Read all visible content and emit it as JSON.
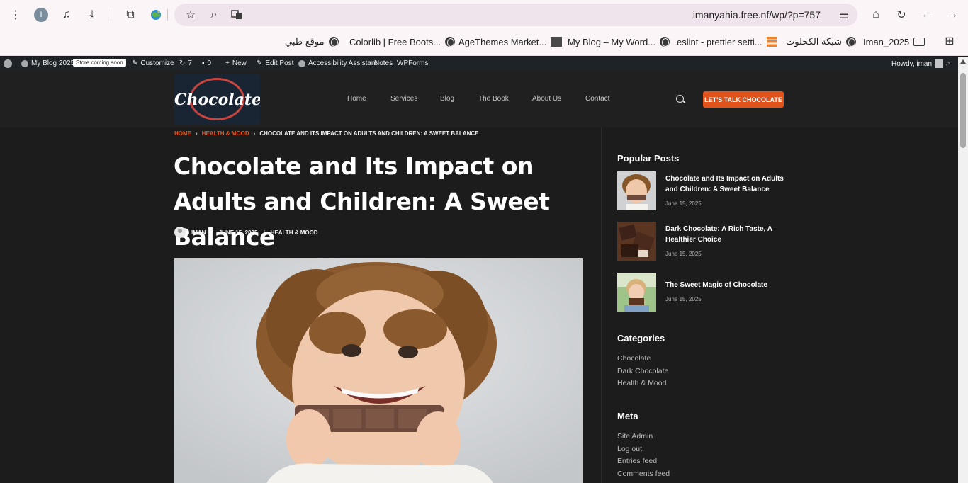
{
  "browser": {
    "url": "imanyahia.free.nf/wp/?p=757",
    "profile_initial": "I",
    "bookmarks": [
      {
        "label": "موقع طبي",
        "icon": "globe-icon"
      },
      {
        "label": "Colorlib | Free Boots...",
        "icon": "globe-icon"
      },
      {
        "label": "AgeThemes Market...",
        "icon": "site-icon"
      },
      {
        "label": "My Blog – My Word...",
        "icon": "globe-icon"
      },
      {
        "label": "eslint - prettier setti...",
        "icon": "stackoverflow-icon"
      },
      {
        "label": "شبكة الكحلوت",
        "icon": "globe-icon"
      },
      {
        "label": "Iman_2025",
        "icon": "folder-icon"
      }
    ]
  },
  "adminbar": {
    "site_name": "My Blog 2025",
    "badge": "Store coming soon",
    "customize": "Customize",
    "updates": "7",
    "comments": "0",
    "new": "New",
    "edit_post": "Edit Post",
    "accessibility": "Accessibility Assistant",
    "notes": "Notes",
    "wpforms": "WPForms",
    "howdy": "Howdy, iman"
  },
  "site": {
    "logo_text": "Chocolate",
    "nav": [
      "Home",
      "Services",
      "Blog",
      "The Book",
      "About Us",
      "Contact"
    ],
    "cta": "LET'S TALK CHOCOLATE"
  },
  "post": {
    "breadcrumb": [
      "HOME",
      "HEALTH & MOOD",
      "CHOCOLATE AND ITS IMPACT ON ADULTS AND CHILDREN: A SWEET BALANCE"
    ],
    "title": "Chocolate and Its Impact on Adults and Children: A Sweet Balance",
    "author": "IMAN",
    "date": "JUNE 15, 2025",
    "category": "HEALTH & MOOD"
  },
  "sidebar": {
    "popular_heading": "Popular Posts",
    "popular": [
      {
        "title": "Chocolate and Its Impact on Adults and Children: A Sweet Balance",
        "date": "June 15, 2025"
      },
      {
        "title": "Dark Chocolate: A Rich Taste, A Healthier Choice",
        "date": "June 15, 2025"
      },
      {
        "title": "The Sweet Magic of Chocolate",
        "date": "June 15, 2025"
      }
    ],
    "categories_heading": "Categories",
    "categories": [
      "Chocolate",
      "Dark Chocolate",
      "Health & Mood"
    ],
    "meta_heading": "Meta",
    "meta": [
      "Site Admin",
      "Log out",
      "Entries feed",
      "Comments feed"
    ]
  }
}
